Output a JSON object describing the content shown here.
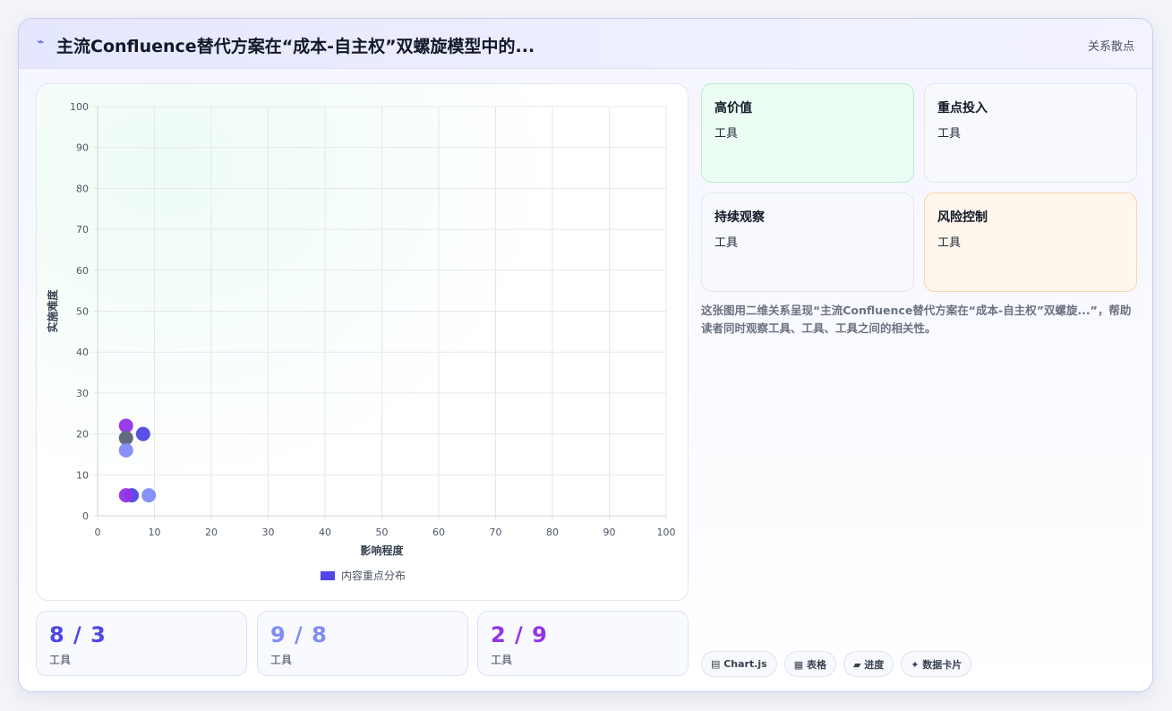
{
  "header": {
    "title": "主流Confluence替代方案在“成本-自主权”双螺旋模型中的...",
    "tag": "关系散点"
  },
  "chart_data": {
    "type": "scatter",
    "xlabel": "影响程度",
    "ylabel": "实施难度",
    "xlim": [
      0,
      100
    ],
    "ylim": [
      0,
      100
    ],
    "x_ticks": [
      "0",
      "10",
      "20",
      "30",
      "40",
      "50",
      "60",
      "70",
      "80",
      "90",
      "100"
    ],
    "y_ticks": [
      "0",
      "10",
      "20",
      "30",
      "40",
      "50",
      "60",
      "70",
      "80",
      "90",
      "100"
    ],
    "grid": true,
    "legend_position": "bottom",
    "series": [
      {
        "name": "内容重点分布",
        "color": "#4f46e5",
        "points": [
          {
            "x": 5,
            "y": 22,
            "color": "#9333ea"
          },
          {
            "x": 5,
            "y": 19,
            "color": "#5b6478"
          },
          {
            "x": 8,
            "y": 20,
            "color": "#4f46e5"
          },
          {
            "x": 5,
            "y": 16,
            "color": "#818cf8"
          },
          {
            "x": 6,
            "y": 5,
            "color": "#4f46e5"
          },
          {
            "x": 9,
            "y": 5,
            "color": "#818cf8"
          },
          {
            "x": 5,
            "y": 5,
            "color": "#9333ea"
          }
        ]
      }
    ]
  },
  "stats": [
    {
      "value": "8 / 3",
      "label": "工具",
      "color": "#4f46e5"
    },
    {
      "value": "9 / 8",
      "label": "工具",
      "color": "#818cf8"
    },
    {
      "value": "2 / 9",
      "label": "工具",
      "color": "#9333ea"
    }
  ],
  "quadrants": [
    {
      "title": "高价值",
      "value": "工具"
    },
    {
      "title": "重点投入",
      "value": "工具"
    },
    {
      "title": "持续观察",
      "value": "工具"
    },
    {
      "title": "风险控制",
      "value": "工具"
    }
  ],
  "description": "这张图用二维关系呈现“主流Confluence替代方案在“成本-自主权”双螺旋...”，帮助读者同时观察工具、工具、工具之间的相关性。",
  "pills": [
    "▤ Chart.js",
    "▦ 表格",
    "▰ 进度",
    "✦ 数据卡片"
  ]
}
